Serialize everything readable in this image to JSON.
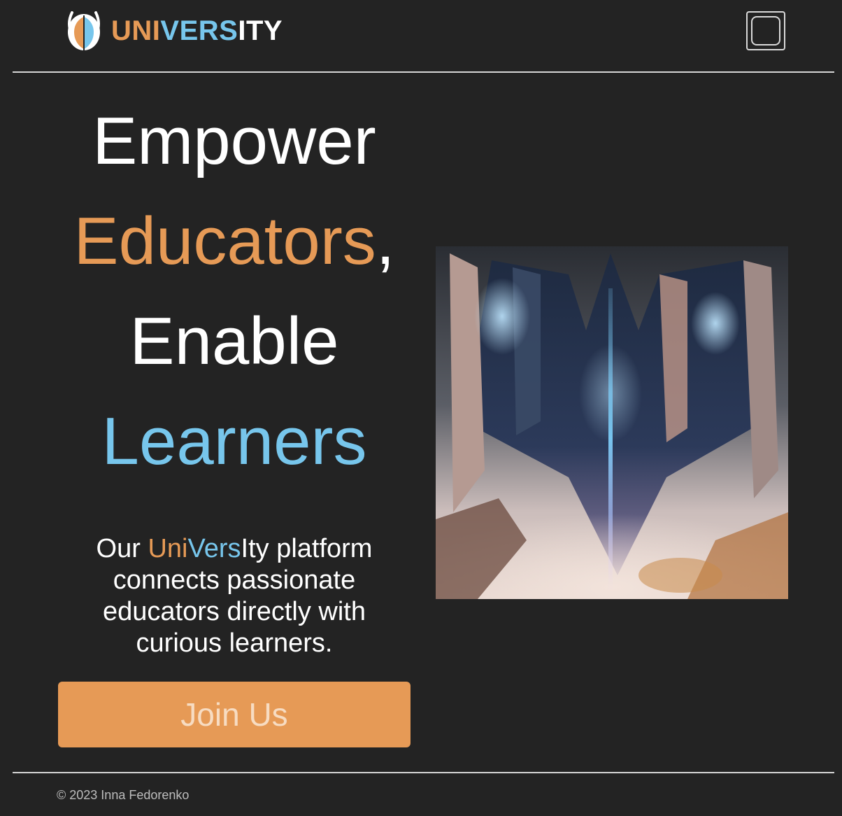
{
  "header": {
    "logo": {
      "parts": [
        "UNI",
        "VERS",
        "ITY"
      ]
    },
    "menu_button_icon": "square-menu-icon"
  },
  "hero": {
    "headline": {
      "line1": "Empower",
      "line2_word": "Educators",
      "line2_punct": ",",
      "line3": "Enable",
      "line4": "Learners"
    },
    "description": {
      "prefix": "Our ",
      "brand_uni": "Uni",
      "brand_vers": "Vers",
      "brand_ity": "Ity",
      "rest": " platform connects passionate educators directly with curious learners."
    },
    "join_label": "Join Us",
    "image_icon": "futuristic-city-illustration"
  },
  "footer": {
    "copyright": "© 2023 Inna Fedorenko"
  },
  "colors": {
    "background": "#232323",
    "accent_orange": "#e69a56",
    "accent_blue": "#77c6ec",
    "divider": "#d6d6d6"
  }
}
